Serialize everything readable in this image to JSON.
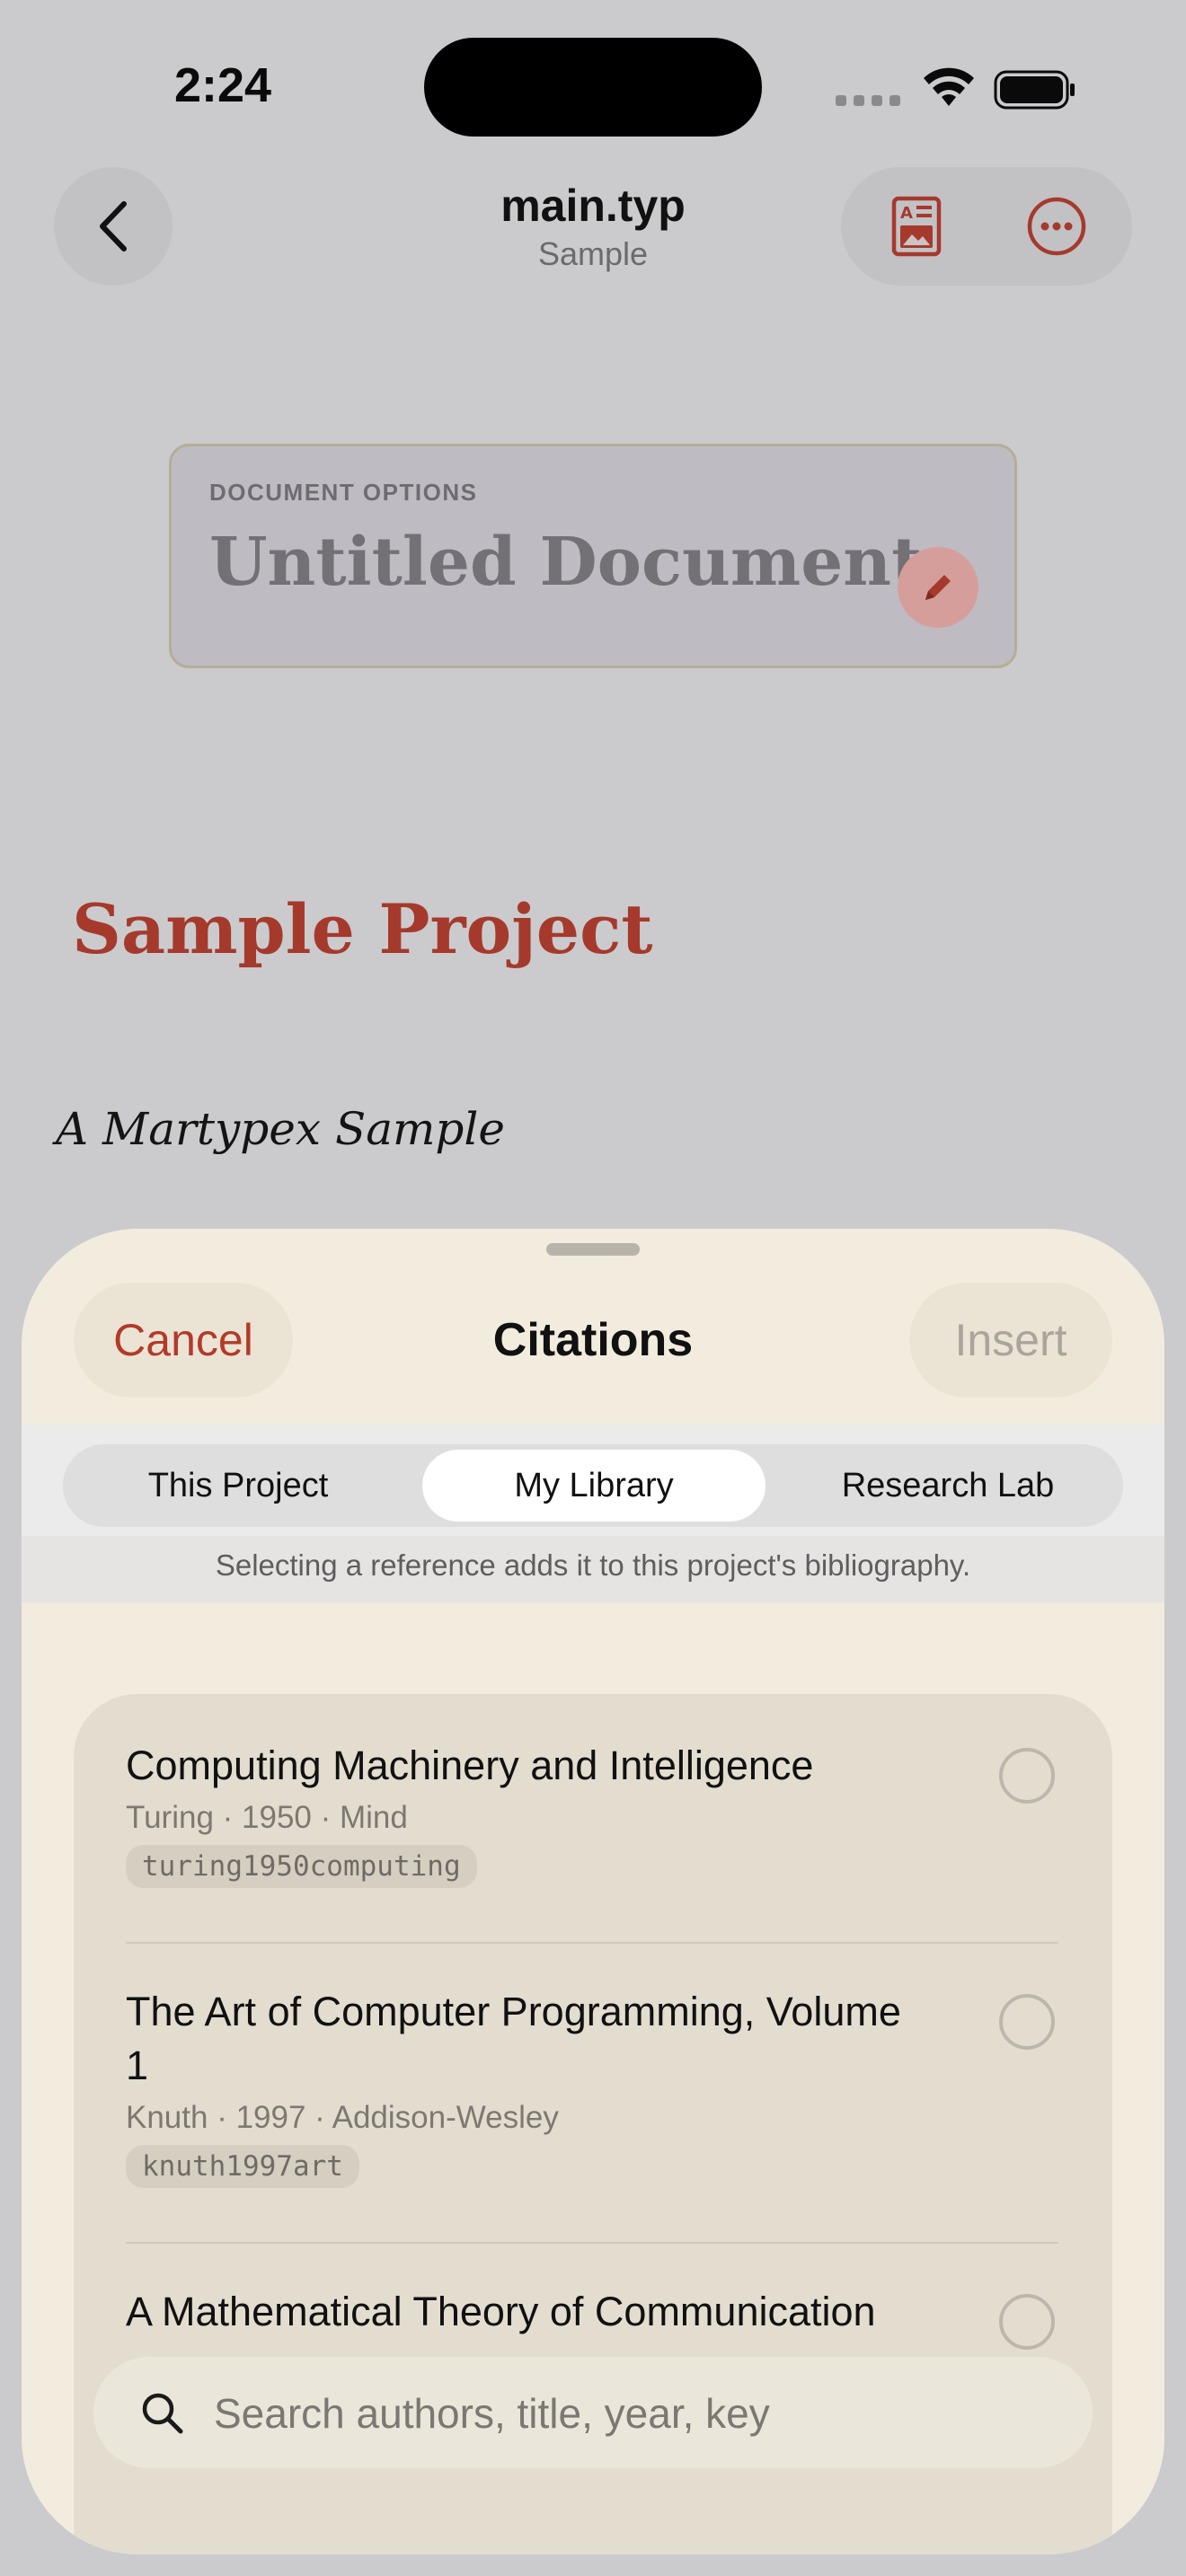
{
  "status_bar": {
    "time": "2:24"
  },
  "nav": {
    "title": "main.typ",
    "subtitle": "Sample",
    "icons": [
      "back-chevron-icon",
      "document-preview-icon",
      "more-ellipsis-icon"
    ],
    "accent_color": "#a53a2c"
  },
  "document_preview": {
    "options_label": "DOCUMENT OPTIONS",
    "options_title": "Untitled Document",
    "heading": "Sample Project",
    "subtitle": "A Martypex Sample"
  },
  "sheet": {
    "cancel_label": "Cancel",
    "title": "Citations",
    "insert_label": "Insert",
    "segments": [
      {
        "label": "This Project",
        "selected": false
      },
      {
        "label": "My Library",
        "selected": true
      },
      {
        "label": "Research Lab",
        "selected": false
      }
    ],
    "hint": "Selecting a reference adds it to this project's bibliography.",
    "references": [
      {
        "title": "Computing Machinery and Intelligence",
        "meta": "Turing · 1950 · Mind",
        "key": "turing1950computing",
        "selected": false
      },
      {
        "title": "The Art of Computer Programming, Volume 1",
        "meta": "Knuth · 1997 · Addison-Wesley",
        "key": "knuth1997art",
        "selected": false
      },
      {
        "title": "A Mathematical Theory of Communication",
        "selected": false
      }
    ],
    "search": {
      "placeholder": "Search authors, title, year, key"
    }
  }
}
